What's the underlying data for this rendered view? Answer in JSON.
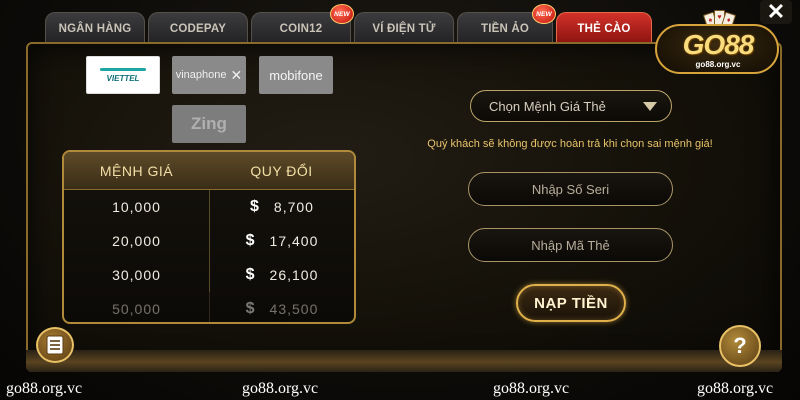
{
  "tabs": [
    {
      "label": "NGÂN HÀNG",
      "new": false,
      "active": false
    },
    {
      "label": "CODEPAY",
      "new": false,
      "active": false
    },
    {
      "label": "COIN12",
      "new": true,
      "active": false
    },
    {
      "label": "VÍ ĐIỆN TỬ",
      "new": false,
      "active": false
    },
    {
      "label": "TIỀN ẢO",
      "new": true,
      "active": false
    },
    {
      "label": "THẺ CÀO",
      "new": false,
      "active": true
    }
  ],
  "new_badge": "NEW",
  "carriers": {
    "viettel": "VIETTEL",
    "vinaphone": "vinaphone",
    "mobifone": "mobifone",
    "zing": "Zing"
  },
  "rate_table": {
    "headers": [
      "MỆNH GIÁ",
      "QUY ĐỔI"
    ],
    "currency_symbol": "$",
    "rows": [
      {
        "denomination": "10,000",
        "value": "8,700"
      },
      {
        "denomination": "20,000",
        "value": "17,400"
      },
      {
        "denomination": "30,000",
        "value": "26,100"
      },
      {
        "denomination": "50,000",
        "value": "43,500"
      }
    ]
  },
  "form": {
    "denomination_select": "Chọn Mệnh Giá Thẻ",
    "warning": "Quý khách sẽ không được hoàn trả khi chọn sai mệnh giá!",
    "serial_placeholder": "Nhập Số Seri",
    "code_placeholder": "Nhập Mã Thẻ",
    "submit_label": "NẠP TIỀN"
  },
  "logo": {
    "text": "GO88",
    "url": "go88.org.vc"
  },
  "help_label": "?",
  "close_label": "✕",
  "watermark": "go88.org.vc",
  "colors": {
    "accent_gold": "#e0b04a",
    "active_tab": "#c8281f",
    "warning_text": "#e8c36a"
  }
}
